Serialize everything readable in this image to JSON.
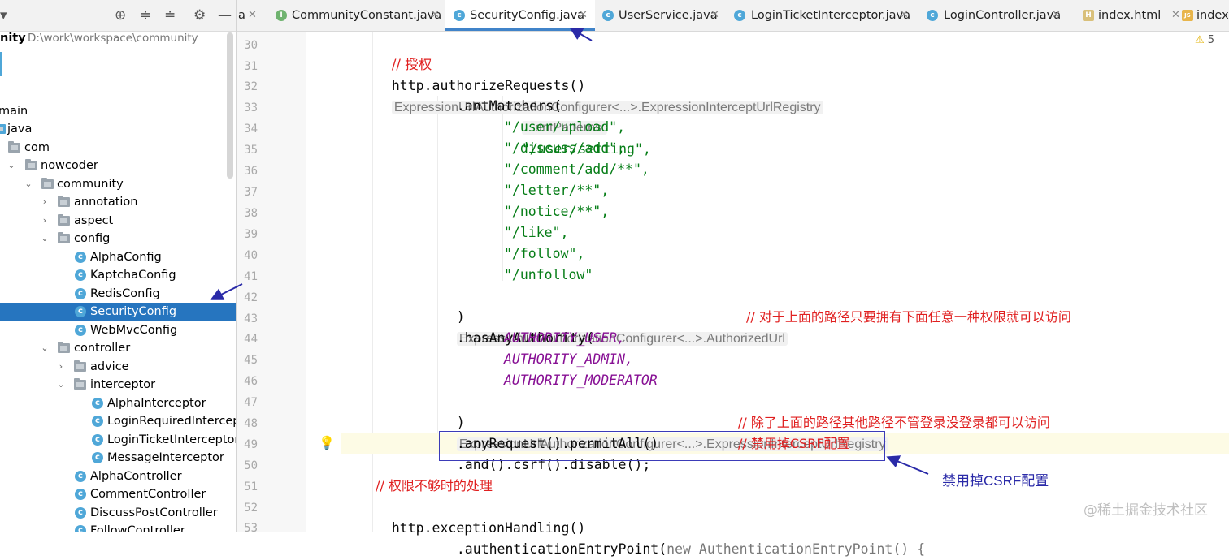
{
  "sidebar": {
    "project_name": "nity",
    "project_path": "D:\\work\\workspace\\community",
    "items": [
      {
        "label": "main",
        "kind": "text"
      },
      {
        "label": "java",
        "kind": "folder"
      },
      {
        "label": "com",
        "kind": "folder"
      },
      {
        "label": "nowcoder",
        "kind": "folder"
      },
      {
        "label": "community",
        "kind": "folder"
      },
      {
        "label": "annotation",
        "kind": "folder"
      },
      {
        "label": "aspect",
        "kind": "folder"
      },
      {
        "label": "config",
        "kind": "folder"
      },
      {
        "label": "AlphaConfig",
        "kind": "class"
      },
      {
        "label": "KaptchaConfig",
        "kind": "class"
      },
      {
        "label": "RedisConfig",
        "kind": "class"
      },
      {
        "label": "SecurityConfig",
        "kind": "class",
        "selected": true
      },
      {
        "label": "WebMvcConfig",
        "kind": "class"
      },
      {
        "label": "controller",
        "kind": "folder"
      },
      {
        "label": "advice",
        "kind": "folder"
      },
      {
        "label": "interceptor",
        "kind": "folder"
      },
      {
        "label": "AlphaInterceptor",
        "kind": "class"
      },
      {
        "label": "LoginRequiredIntercept",
        "kind": "class"
      },
      {
        "label": "LoginTicketInterceptor",
        "kind": "class"
      },
      {
        "label": "MessageInterceptor",
        "kind": "class"
      },
      {
        "label": "AlphaController",
        "kind": "class"
      },
      {
        "label": "CommentController",
        "kind": "class"
      },
      {
        "label": "DiscussPostController",
        "kind": "class"
      },
      {
        "label": "FollowController",
        "kind": "class"
      }
    ]
  },
  "tabs": [
    {
      "label": "a",
      "icon": "none"
    },
    {
      "label": "CommunityConstant.java",
      "icon": "interface-icon"
    },
    {
      "label": "SecurityConfig.java",
      "icon": "class-icon",
      "active": true
    },
    {
      "label": "UserService.java",
      "icon": "class-icon"
    },
    {
      "label": "LoginTicketInterceptor.java",
      "icon": "class-icon"
    },
    {
      "label": "LoginController.java",
      "icon": "class-icon"
    },
    {
      "label": "index.html",
      "icon": "html-icon"
    },
    {
      "label": "index",
      "icon": "js-icon"
    }
  ],
  "editor": {
    "line_numbers": [
      "30",
      "31",
      "32",
      "33",
      "34",
      "35",
      "36",
      "37",
      "38",
      "39",
      "40",
      "41",
      "42",
      "43",
      "44",
      "45",
      "46",
      "47",
      "48",
      "49",
      "50",
      "51",
      "52",
      "53"
    ],
    "code": {
      "l30": "// 授权",
      "l31_code": "http.authorizeRequests()",
      "l31_hint": "ExpressionUrlAuthorizationConfigurer<...>.ExpressionInterceptUrlRegistry",
      "l32": ".antMatchers(",
      "l33_hint": "...antPatterns:",
      "l33_code": "\"/user/setting\",",
      "l34": "\"/user/upload\",",
      "l35": "\"/discuss/add\",",
      "l36": "\"/comment/add/**\",",
      "l37": "\"/letter/**\",",
      "l38": "\"/notice/**\",",
      "l39": "\"/like\",",
      "l40": "\"/follow\",",
      "l41": "\"/unfollow\"",
      "l42_code": ")",
      "l42_hint": "ExpressionUrlAuthorizationConfigurer<...>.AuthorizedUrl",
      "l43_code": ".hasAnyAuthority(",
      "l43_comment": "// 对于上面的路径只要拥有下面任意一种权限就可以访问",
      "l44": "AUTHORITY_USER,",
      "l45": "AUTHORITY_ADMIN,",
      "l46": "AUTHORITY_MODERATOR",
      "l47_code": ")",
      "l47_hint": "ExpressionUrlAuthorizationConfigurer<...>.ExpressionInterceptUrlRegistry",
      "l48_code": ".anyRequest().permitAll()",
      "l48_comment": "// 除了上面的路径其他路径不管登录没登录都可以访问",
      "l49_code": ".and().csrf().disable();",
      "l49_comment": "// 禁用掉CSRF配置",
      "l51": "// 权限不够时的处理",
      "l52": "http.exceptionHandling()",
      "l53_code": ".authenticationEntryPoint(",
      "l53_new": "new",
      "l53_rest": "AuthenticationEntryPoint() {"
    },
    "warning_count": "5",
    "annotation_label": "禁用掉CSRF配置"
  },
  "watermark": "@稀土掘金技术社区",
  "colors": {
    "selection": "#2675bf",
    "comment": "#e02020",
    "string": "#067d17",
    "constant": "#871094",
    "annotation": "#2a2aa8"
  }
}
